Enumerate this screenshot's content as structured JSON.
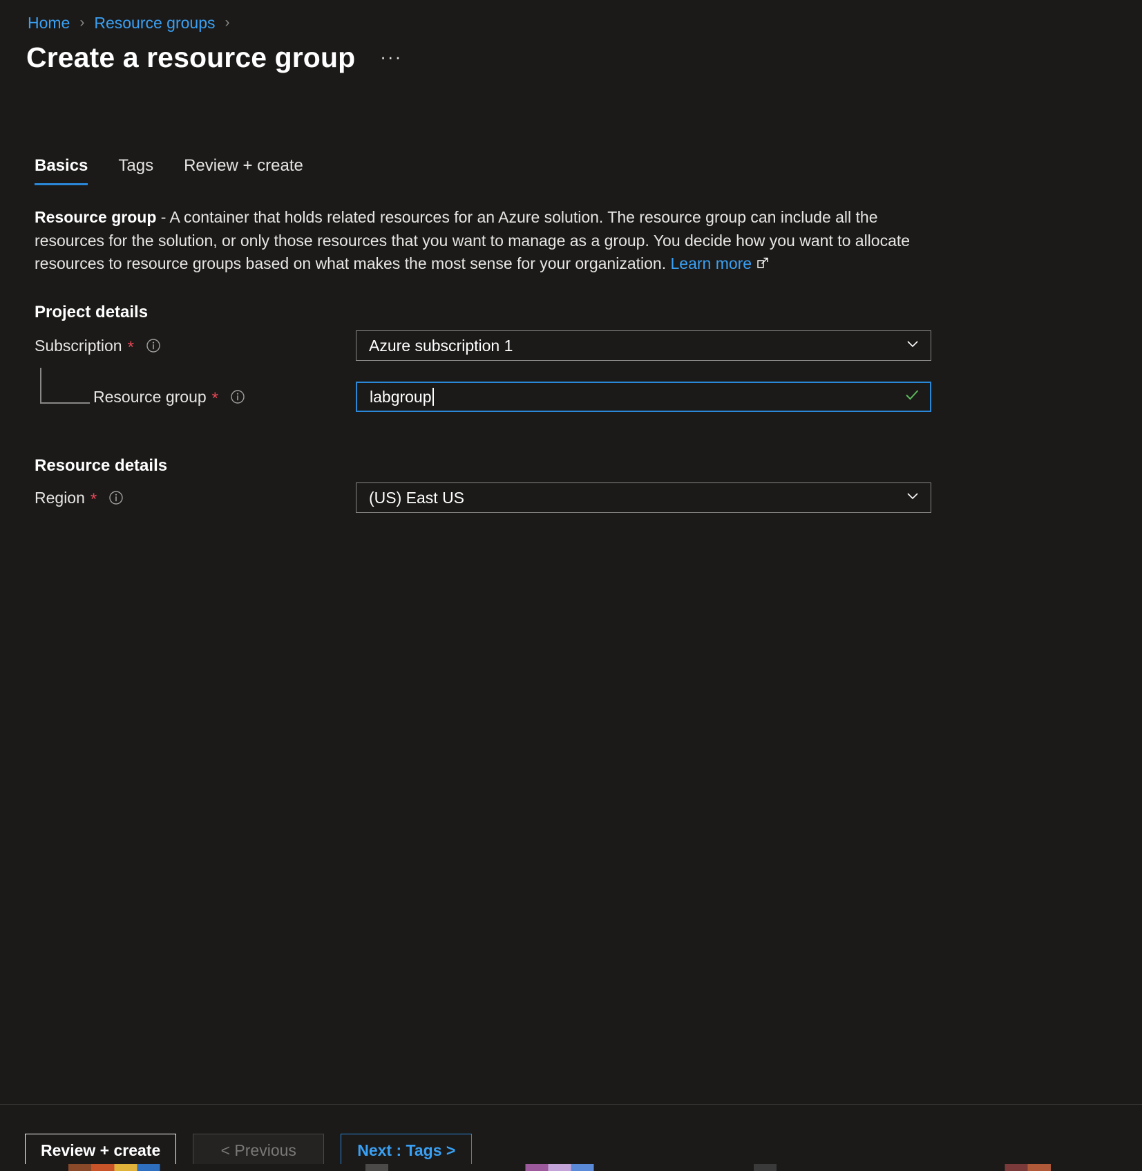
{
  "breadcrumb": {
    "items": [
      {
        "label": "Home"
      },
      {
        "label": "Resource groups"
      }
    ],
    "separator": "›"
  },
  "header": {
    "title": "Create a resource group",
    "ellipsis": "···"
  },
  "tabs": [
    {
      "label": "Basics",
      "active": true
    },
    {
      "label": "Tags",
      "active": false
    },
    {
      "label": "Review + create",
      "active": false
    }
  ],
  "description": {
    "bold_lead": "Resource group",
    "body": " - A container that holds related resources for an Azure solution. The resource group can include all the resources for the solution, or only those resources that you want to manage as a group. You decide how you want to allocate resources to resource groups based on what makes the most sense for your organization. ",
    "link_label": "Learn more",
    "link_icon": "external-link-icon"
  },
  "sections": {
    "project_details": {
      "heading": "Project details",
      "fields": {
        "subscription": {
          "label": "Subscription",
          "required_marker": "*",
          "info_icon": "info-icon",
          "value": "Azure subscription 1",
          "control": "dropdown",
          "chevron_icon": "chevron-down-icon"
        },
        "resource_group": {
          "label": "Resource group",
          "required_marker": "*",
          "info_icon": "info-icon",
          "value": "labgroup",
          "placeholder": "",
          "control": "textbox",
          "state": "focused",
          "validation_icon": "check-icon"
        }
      }
    },
    "resource_details": {
      "heading": "Resource details",
      "fields": {
        "region": {
          "label": "Region",
          "required_marker": "*",
          "info_icon": "info-icon",
          "value": "(US) East US",
          "control": "dropdown",
          "chevron_icon": "chevron-down-icon"
        }
      }
    }
  },
  "footer": {
    "review_create": "Review + create",
    "previous": "< Previous",
    "next": "Next : Tags >"
  },
  "colors": {
    "background": "#1b1a19",
    "link": "#3aa0f3",
    "accent": "#2b88d8",
    "required": "#e74856",
    "valid": "#5cb85c",
    "border": "#8a8886"
  }
}
